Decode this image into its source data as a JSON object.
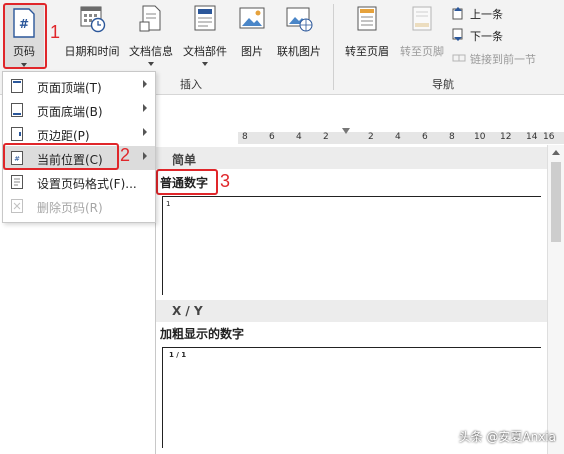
{
  "ribbon": {
    "insert_group": {
      "buttons": [
        {
          "label": "页码",
          "icon": "page-number-icon"
        },
        {
          "label": "日期和时间",
          "icon": "calendar-clock-icon"
        },
        {
          "label": "文档信息",
          "icon": "document-info-icon"
        },
        {
          "label": "文档部件",
          "icon": "quick-parts-icon"
        },
        {
          "label": "图片",
          "icon": "picture-icon"
        },
        {
          "label": "联机图片",
          "icon": "online-picture-icon"
        }
      ],
      "name": "插入"
    },
    "nav_group": {
      "goto_header": "转至页眉",
      "goto_footer": "转至页脚",
      "prev": "上一条",
      "next": "下一条",
      "link_prev": "链接到前一节",
      "name": "导航"
    }
  },
  "menu": {
    "items": [
      {
        "label": "页面顶端(T)",
        "icon": "page-top-icon"
      },
      {
        "label": "页面底端(B)",
        "icon": "page-bottom-icon"
      },
      {
        "label": "页边距(P)",
        "icon": "page-margin-icon"
      },
      {
        "label": "当前位置(C)",
        "icon": "current-position-icon"
      },
      {
        "label": "设置页码格式(F)...",
        "icon": "format-page-number-icon"
      },
      {
        "label": "删除页码(R)",
        "icon": "remove-page-number-icon"
      }
    ]
  },
  "annotations": {
    "one": "1",
    "two": "2",
    "three": "3"
  },
  "ruler": {
    "ticks": [
      "8",
      "6",
      "4",
      "2",
      "2",
      "4",
      "6",
      "8",
      "10",
      "12",
      "14",
      "16"
    ]
  },
  "gallery": {
    "section1": "简单",
    "item1_label": "普通数字",
    "item1_preview": "1",
    "section2": "X / Y",
    "item2_label": "加粗显示的数字",
    "item2_preview": "1 / 1"
  },
  "watermark": "头条 @安夏Anxia",
  "colors": {
    "annotation_red": "#e0262a",
    "selected_bg": "#dcdcdc"
  }
}
